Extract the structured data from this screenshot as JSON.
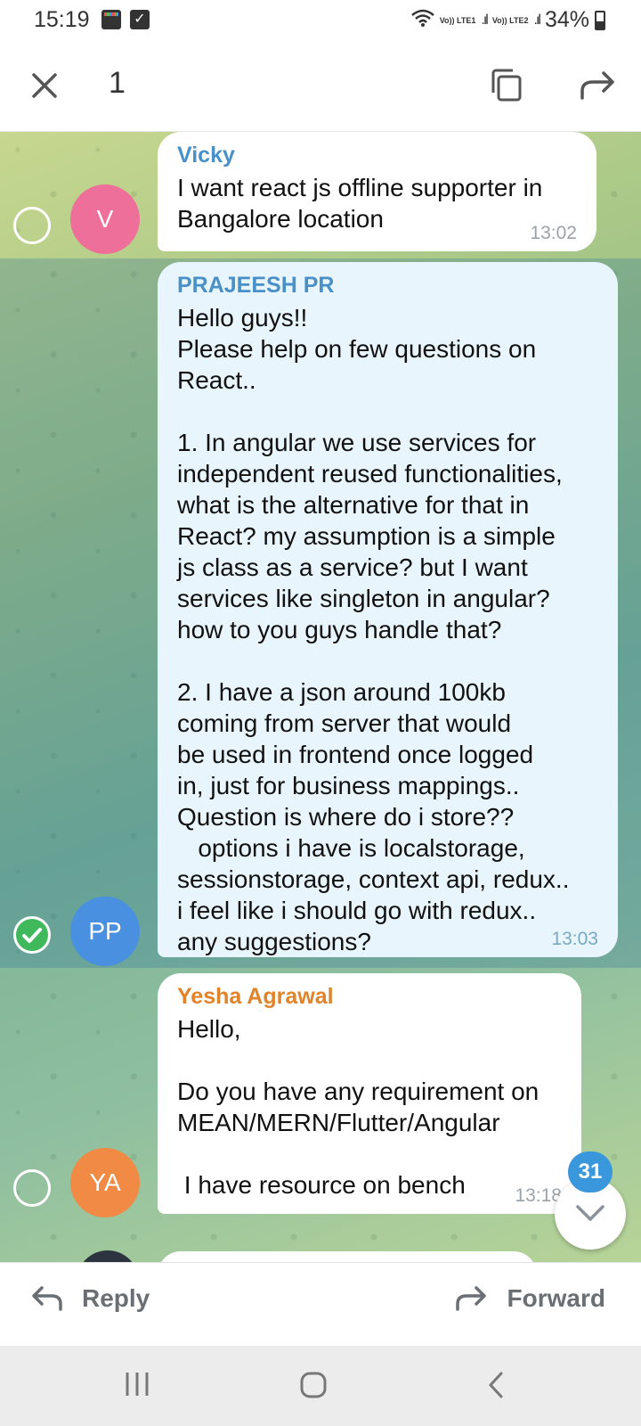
{
  "status_bar": {
    "time": "15:19",
    "network1": "Vo)) LTE1",
    "network2": "Vo)) LTE2",
    "battery": "34%"
  },
  "selection_bar": {
    "selected_count": "1",
    "icons": [
      "close-icon",
      "copy-icon",
      "forward-icon"
    ]
  },
  "messages": [
    {
      "sender": "Vicky",
      "sender_color": "#4a90c8",
      "avatar_initials": "V",
      "avatar_color": "#ee6f9a",
      "text": "I want react js offline supporter in\nBangalore location",
      "time": "13:02",
      "selected": false
    },
    {
      "sender": "PRAJEESH PR",
      "sender_color": "#4a90c8",
      "avatar_initials": "PP",
      "avatar_color": "#4a90e0",
      "text": "Hello guys!!\nPlease help on few questions on\nReact..\n\n1. In angular we use services for\nindependent reused functionalities,\nwhat is the alternative for that in\nReact? my assumption is a simple\njs class as a service? but I want\nservices like singleton in angular?\nhow to you guys handle that?\n\n2. I have a json around 100kb\ncoming from server that would\nbe used in frontend once logged\nin, just for business mappings..\nQuestion is where do i store??\n   options i have is localstorage,\nsessionstorage, context api, redux..\ni feel like i should go with redux..\nany suggestions?",
      "time": "13:03",
      "selected": true
    },
    {
      "sender": "Yesha Agrawal",
      "sender_color": "#e0832a",
      "avatar_initials": "YA",
      "avatar_color": "#f08a44",
      "text": "Hello,\n\nDo you have any requirement on\nMEAN/MERN/Flutter/Angular\n\n I have resource on bench",
      "time": "13:18",
      "selected": false
    }
  ],
  "scroll_down": {
    "unread_count": "31"
  },
  "action_bar": {
    "reply_label": "Reply",
    "forward_label": "Forward"
  },
  "nav_bar": {
    "icons": [
      "recent-apps-icon",
      "home-icon",
      "back-icon"
    ]
  }
}
